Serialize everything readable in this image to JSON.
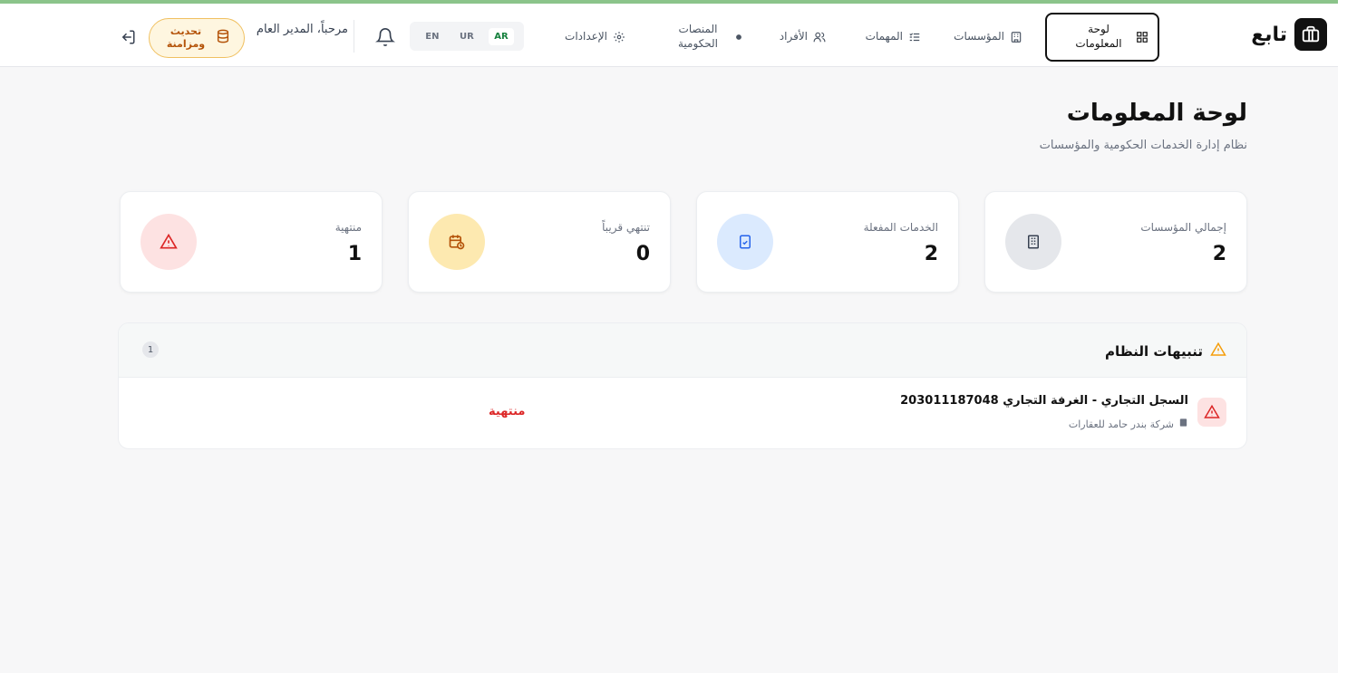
{
  "app": {
    "name": "تابع"
  },
  "nav": {
    "items": [
      {
        "label": "لوحة المعلومات",
        "icon": "dashboard-icon"
      },
      {
        "label": "المؤسسات",
        "icon": "building-icon"
      },
      {
        "label": "المهمات",
        "icon": "tasks-icon"
      },
      {
        "label": "الأفراد",
        "icon": "users-icon"
      },
      {
        "label": "المنصات الحكومية",
        "icon": "globe-icon"
      },
      {
        "label": "الإعدادات",
        "icon": "settings-icon"
      }
    ],
    "languages": [
      "AR",
      "UR",
      "EN"
    ],
    "active_language": "AR",
    "greeting": "مرحباً، المدير العام",
    "sync_label": "تحديث ومزامنة"
  },
  "page": {
    "title": "لوحة المعلومات",
    "subtitle": "نظام إدارة الخدمات الحكومية والمؤسسات"
  },
  "stats": [
    {
      "label": "إجمالي المؤسسات",
      "value": "2",
      "icon": "building-icon",
      "color": "#e5e7eb"
    },
    {
      "label": "الخدمات المفعلة",
      "value": "2",
      "icon": "file-check-icon",
      "color": "#dbeafe"
    },
    {
      "label": "تنتهي قريباً",
      "value": "0",
      "icon": "calendar-clock-icon",
      "color": "#fde9b0"
    },
    {
      "label": "منتهية",
      "value": "1",
      "icon": "warning-icon",
      "color": "#fde2e2"
    }
  ],
  "alerts": {
    "title": "تنبيهات النظام",
    "count": "1",
    "items": [
      {
        "title": "السجل التجاري - الغرفة التجاري 203011187048",
        "company": "شركة بندر حامد للعقارات",
        "status": "منتهية"
      }
    ]
  },
  "colors": {
    "accent": "#15803d",
    "danger": "#dc2626",
    "warning": "#f59e0b",
    "sync_bg": "#fef6e0"
  }
}
